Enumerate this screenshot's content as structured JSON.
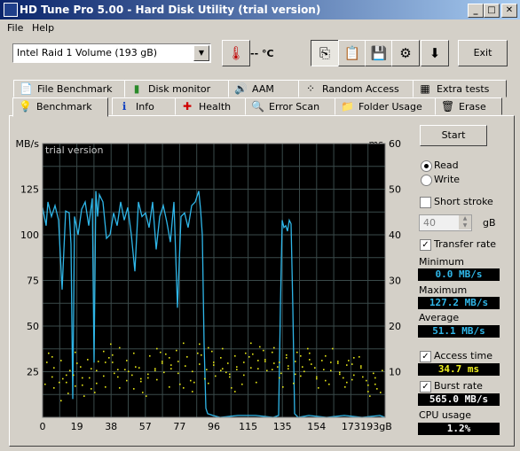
{
  "window": {
    "title": "HD Tune Pro 5.00 - Hard Disk Utility (trial version)"
  },
  "menu": {
    "file": "File",
    "help": "Help"
  },
  "toolbar": {
    "drive": "Intel   Raid 1 Volume (193 gB)",
    "temperature": "-- °C",
    "exit": "Exit"
  },
  "tabs_top": [
    {
      "label": "File Benchmark"
    },
    {
      "label": "Disk monitor"
    },
    {
      "label": "AAM"
    },
    {
      "label": "Random Access"
    },
    {
      "label": "Extra tests"
    }
  ],
  "tabs_bottom": [
    {
      "label": "Benchmark"
    },
    {
      "label": "Info"
    },
    {
      "label": "Health"
    },
    {
      "label": "Error Scan"
    },
    {
      "label": "Folder Usage"
    },
    {
      "label": "Erase"
    }
  ],
  "controls": {
    "start": "Start",
    "read": "Read",
    "write": "Write",
    "short_stroke": "Short stroke",
    "short_stroke_value": "40",
    "short_stroke_unit": "gB",
    "transfer_rate": "Transfer rate",
    "access_time": "Access time",
    "burst_rate": "Burst rate"
  },
  "stats": {
    "minimum_label": "Minimum",
    "minimum": "0.0 MB/s",
    "maximum_label": "Maximum",
    "maximum": "127.2 MB/s",
    "average_label": "Average",
    "average": "51.1 MB/s",
    "access_time": "34.7 ms",
    "burst_rate": "565.0 MB/s",
    "cpu_label": "CPU usage",
    "cpu": "1.2%"
  },
  "colors": {
    "transfer": "#2fb6e8",
    "access": "#e8e817",
    "chart_bg": "#000000",
    "grid": "#3a4a4a"
  },
  "chart_data": {
    "type": "line",
    "watermark": "trial version",
    "ylabel_left": "MB/s",
    "ylabel_right": "ms",
    "ylim_left": [
      0,
      150
    ],
    "ylim_right": [
      0,
      60
    ],
    "xlim": [
      0,
      193
    ],
    "xticks": [
      "0",
      "19",
      "38",
      "57",
      "77",
      "96",
      "115",
      "135",
      "154",
      "173",
      "193gB"
    ],
    "yticks_left": [
      "25",
      "50",
      "75",
      "100",
      "125"
    ],
    "yticks_right": [
      "10",
      "20",
      "30",
      "40",
      "50",
      "60"
    ],
    "series": [
      {
        "name": "Transfer rate",
        "axis": "left",
        "x": [
          0,
          2,
          3,
          5,
          7,
          9,
          11,
          13,
          15,
          16,
          17,
          18,
          20,
          22,
          24,
          26,
          28,
          29,
          30,
          31,
          32,
          34,
          36,
          38,
          40,
          42,
          44,
          46,
          48,
          50,
          52,
          54,
          56,
          58,
          60,
          62,
          64,
          66,
          68,
          70,
          72,
          74,
          76,
          78,
          80,
          82,
          84,
          86,
          88,
          89,
          90,
          91,
          92,
          93,
          96,
          100,
          110,
          120,
          130,
          133,
          134,
          135,
          136,
          137,
          138,
          139,
          140,
          141,
          142,
          143,
          144,
          150,
          160,
          170,
          180,
          190,
          193
        ],
        "y": [
          115,
          105,
          118,
          110,
          116,
          108,
          70,
          113,
          112,
          95,
          10,
          110,
          100,
          114,
          118,
          105,
          120,
          30,
          124,
          110,
          122,
          118,
          98,
          100,
          112,
          105,
          118,
          108,
          115,
          100,
          80,
          118,
          110,
          112,
          104,
          118,
          92,
          110,
          116,
          107,
          96,
          118,
          60,
          110,
          112,
          104,
          116,
          118,
          124,
          114,
          100,
          40,
          5,
          2,
          1,
          0,
          1,
          1,
          0,
          1,
          60,
          108,
          104,
          105,
          102,
          108,
          106,
          60,
          2,
          1,
          0,
          1,
          0,
          1,
          0,
          1,
          0
        ]
      },
      {
        "name": "Access time",
        "axis": "right",
        "x": [
          2,
          8,
          14,
          20,
          26,
          32,
          38,
          44,
          50,
          56,
          62,
          68,
          74,
          80,
          86,
          92,
          98,
          104,
          110,
          116,
          122,
          128,
          134,
          140,
          146,
          152,
          158,
          164,
          170,
          176,
          182,
          188
        ],
        "y": [
          9,
          11,
          7,
          12,
          8,
          10,
          13,
          9,
          11,
          8,
          12,
          10,
          14,
          9,
          11,
          13,
          10,
          12,
          9,
          11,
          14,
          12,
          13,
          10,
          12,
          11,
          9,
          12,
          10,
          11,
          9,
          8
        ]
      }
    ]
  }
}
